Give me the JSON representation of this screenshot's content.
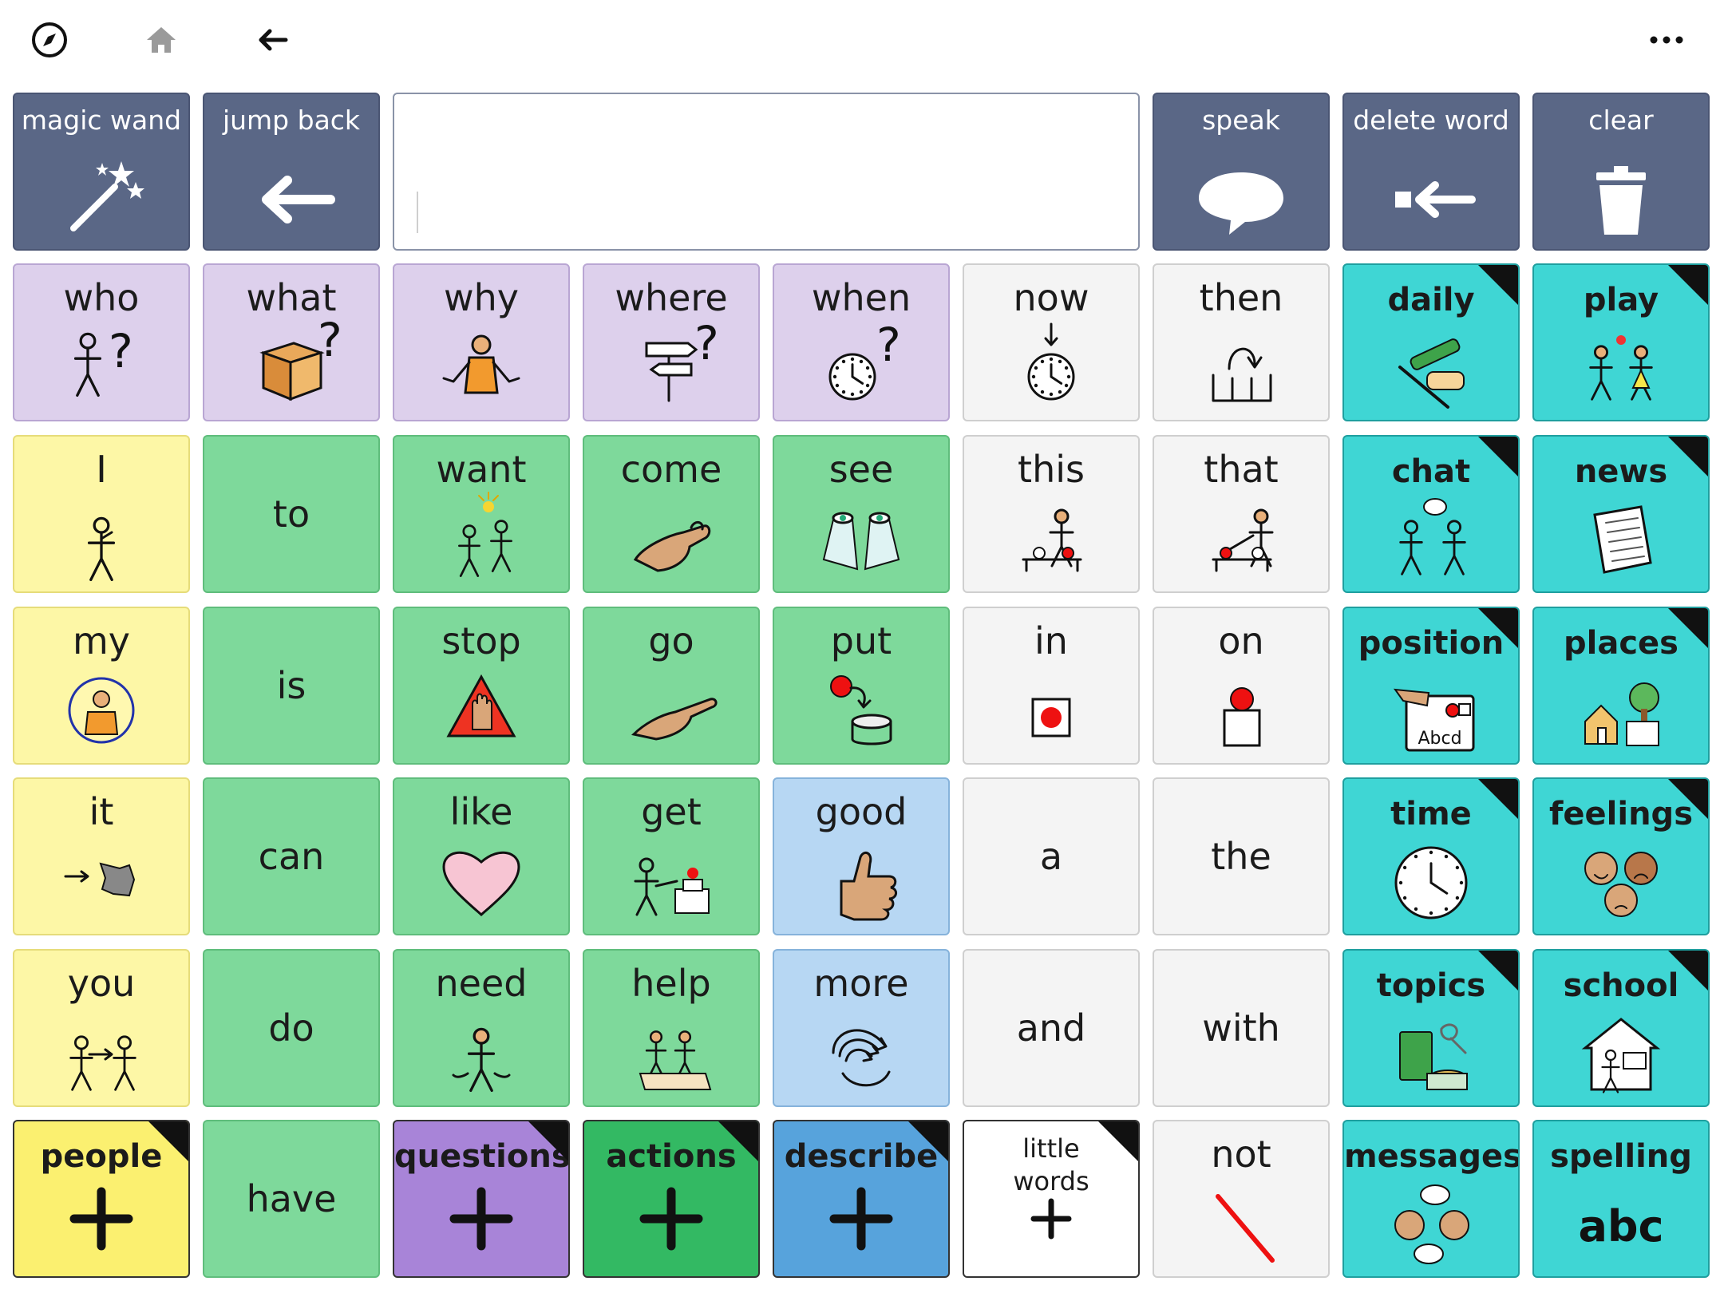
{
  "toolbar": {
    "compass_icon": "compass-icon",
    "home_icon": "home-icon",
    "back_icon": "back-arrow-icon",
    "more_icon": "more-icon"
  },
  "controls": {
    "magic_wand": "magic wand",
    "jump_back": "jump back",
    "message": "",
    "speak": "speak",
    "delete_word": "delete word",
    "clear": "clear"
  },
  "rows": [
    [
      "who",
      "what",
      "why",
      "where",
      "when",
      "now",
      "then",
      "daily",
      "play"
    ],
    [
      "I",
      "to",
      "want",
      "come",
      "see",
      "this",
      "that",
      "chat",
      "news"
    ],
    [
      "my",
      "is",
      "stop",
      "go",
      "put",
      "in",
      "on",
      "position",
      "places"
    ],
    [
      "it",
      "can",
      "like",
      "get",
      "good",
      "a",
      "the",
      "time",
      "feelings"
    ],
    [
      "you",
      "do",
      "need",
      "help",
      "more",
      "and",
      "with",
      "topics",
      "school"
    ],
    [
      "people",
      "have",
      "questions",
      "actions",
      "describe",
      "little words",
      "not",
      "messages",
      "spelling"
    ]
  ],
  "symbol_text": {
    "position": "Abcd",
    "spelling": "abc"
  },
  "colors": {
    "controls": "#5a6786",
    "questions": "#ddd0ec",
    "people": "#fdf7a6",
    "actions": "#7ed99b",
    "describe": "#b7d7f3",
    "little_words": "#f4f4f4",
    "topics": "#3fd6d4"
  }
}
